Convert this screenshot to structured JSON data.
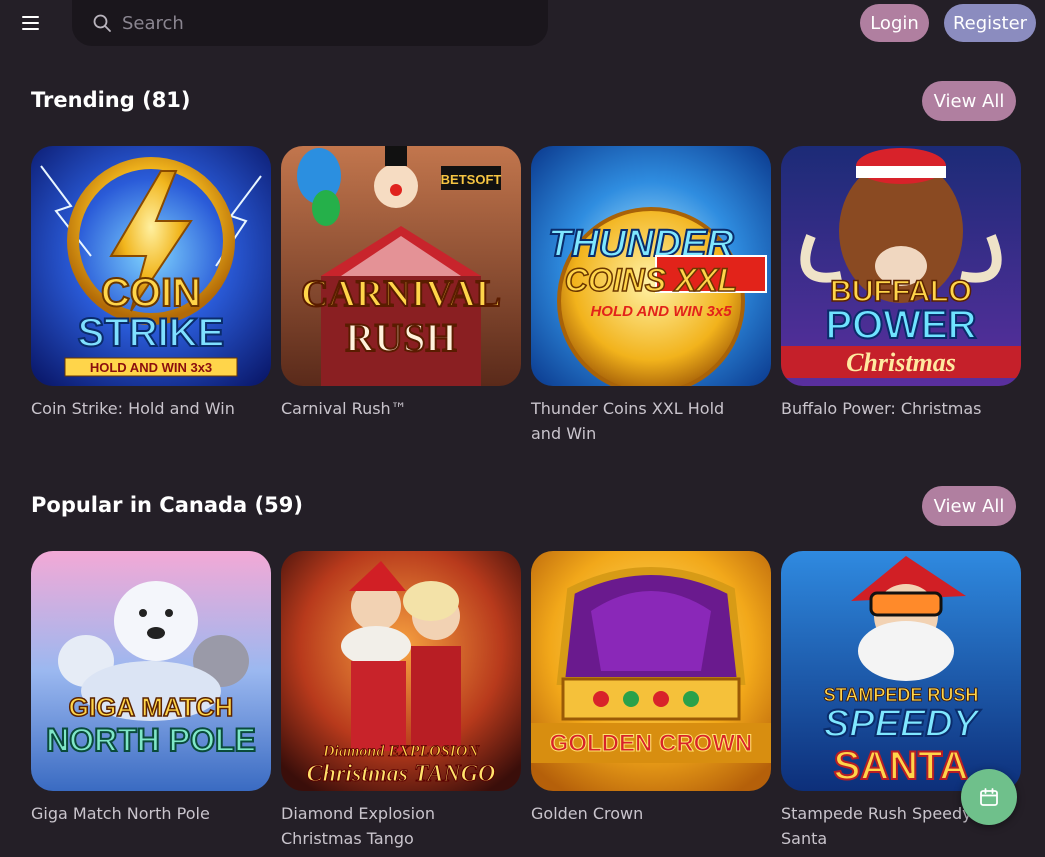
{
  "header": {
    "search_placeholder": "Search",
    "login_label": "Login",
    "register_label": "Register"
  },
  "sections": [
    {
      "title": "Trending (81)",
      "view_all_label": "View All",
      "games": [
        {
          "title": "Coin Strike: Hold and Win",
          "art_lines": [
            "COIN",
            "STRIKE",
            "HOLD AND WIN 3x3"
          ]
        },
        {
          "title": "Carnival Rush™",
          "art_lines": [
            "CARNIVAL",
            "RUSH",
            "BETSOFT"
          ]
        },
        {
          "title": "Thunder Coins XXL Hold and Win",
          "art_lines": [
            "THUNDER",
            "COINS XXL",
            "HOLD AND WIN 3x5"
          ]
        },
        {
          "title": "Buffalo Power: Christmas",
          "art_lines": [
            "BUFFALO",
            "POWER",
            "Christmas"
          ]
        }
      ]
    },
    {
      "title": "Popular in Canada (59)",
      "view_all_label": "View All",
      "games": [
        {
          "title": "Giga Match North Pole",
          "art_lines": [
            "GIGA MATCH",
            "NORTH POLE"
          ]
        },
        {
          "title": "Diamond Explosion Christmas Tango",
          "art_lines": [
            "Diamond EXPLOSION",
            "Christmas TANGO"
          ]
        },
        {
          "title": "Golden Crown",
          "art_lines": [
            "GOLDEN CROWN"
          ]
        },
        {
          "title": "Stampede Rush Speedy Santa",
          "art_lines": [
            "STAMPEDE RUSH",
            "SPEEDY",
            "SANTA"
          ]
        }
      ]
    }
  ],
  "icons": {
    "menu": "hamburger-icon",
    "search": "search-icon",
    "fab": "calendar-icon"
  },
  "colors": {
    "background": "#241f27",
    "login": "#b07fa0",
    "register": "#8b8cbf",
    "view_all": "#b07fa0",
    "fab": "#6fc08b"
  }
}
